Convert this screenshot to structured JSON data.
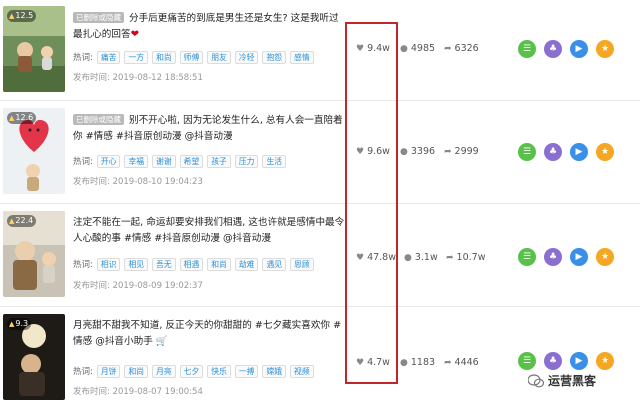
{
  "tags_label": "热词:",
  "time_label": "发布时间:",
  "deleted_tag": "已删除或隐藏",
  "watermark": "运营黑客",
  "colors": {
    "highlight": "#c0272d",
    "tag_text": "#2a8fd7",
    "green": "#59c04a",
    "purple": "#8a6fd1",
    "blue": "#3a8fe6",
    "orange": "#f5a623"
  },
  "videos": [
    {
      "score": "12.5",
      "deleted": true,
      "title": "分手后更痛苦的到底是男生还是女生? 这是我听过最扎心的回答",
      "tags": [
        "痛苦",
        "一方",
        "和尚",
        "师傅",
        "朋友",
        "冷轻",
        "抱怨",
        "感情"
      ],
      "time": "2019-08-12 18:58:51",
      "likes": "9.4w",
      "comments": "4985",
      "shares": "6326"
    },
    {
      "score": "12.6",
      "deleted": true,
      "title": "别不开心啦, 因为无论发生什么, 总有人会一直陪着你 #情感 #抖音原创动漫 @抖音动漫",
      "tags": [
        "开心",
        "幸福",
        "谢谢",
        "希望",
        "孩子",
        "压力",
        "生活"
      ],
      "time": "2019-08-10 19:04:23",
      "likes": "9.6w",
      "comments": "3396",
      "shares": "2999"
    },
    {
      "score": "22.4",
      "deleted": false,
      "title": "注定不能在一起, 命运却要安排我们相遇, 这也许就是感情中最令人心酸的事 #情感 #抖音原创动漫 @抖音动漫",
      "tags": [
        "相识",
        "相见",
        "吾无",
        "相遇",
        "和尚",
        "劫难",
        "遇见",
        "恩顾"
      ],
      "time": "2019-08-09 19:02:37",
      "likes": "47.8w",
      "comments": "3.1w",
      "shares": "10.7w"
    },
    {
      "score": "9.3",
      "deleted": false,
      "title": "月亮甜不甜我不知道, 反正今天的你甜甜的 #七夕藏实喜欢你 #情感 @抖音小助手",
      "tags": [
        "月饼",
        "和尚",
        "月亮",
        "七夕",
        "快乐",
        "一搏",
        "嫦娥",
        "视频"
      ],
      "time": "2019-08-07 19:00:54",
      "likes": "4.7w",
      "comments": "1183",
      "shares": "4446"
    }
  ]
}
